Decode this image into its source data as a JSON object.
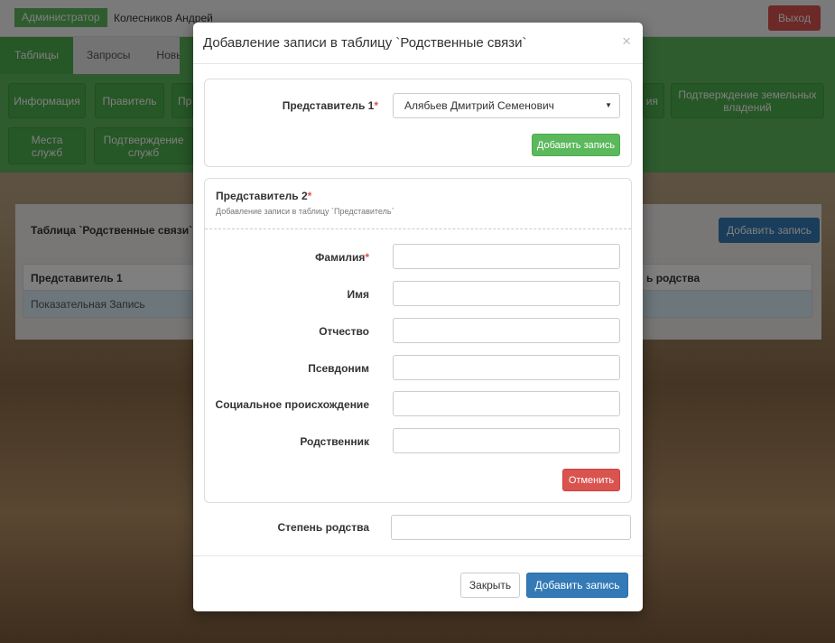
{
  "topbar": {
    "role": "Администратор",
    "user": "Колесников Андрей",
    "logout": "Выход"
  },
  "nav": {
    "tabs": [
      "Таблицы",
      "Запросы",
      "Новые"
    ]
  },
  "table_buttons": {
    "info": "Информация",
    "ruler": "Правитель",
    "partial": "Пр",
    "right_partial": "ия",
    "land": "Подтверждение земельных владений",
    "places": "Места служб",
    "confirm_services": "Подтверждение служб"
  },
  "panel": {
    "title": "Таблица `Родственные связи`",
    "add_button": "Добавить запись",
    "col1": "Представитель 1",
    "col3": "ь родства",
    "row1": "Показательная Запись"
  },
  "modal": {
    "title": "Добавление записи в таблицу `Родственные связи`",
    "close": "×",
    "rep1_label": "Представитель 1",
    "rep1_value": "Алябьев Дмитрий Семенович",
    "rep1_add": "Добавить запись",
    "rep2_label": "Представитель 2",
    "rep2_desc": "Добавление записи в таблицу `Представитель`",
    "fields": {
      "surname": "Фамилия",
      "name": "Имя",
      "patronymic": "Отчество",
      "pseudonym": "Псевдоним",
      "origin": "Социальное происхождение",
      "relative": "Родственник"
    },
    "cancel": "Отменить",
    "degree_label": "Степень родства",
    "close_button": "Закрыть",
    "submit_button": "Добавить запись"
  }
}
